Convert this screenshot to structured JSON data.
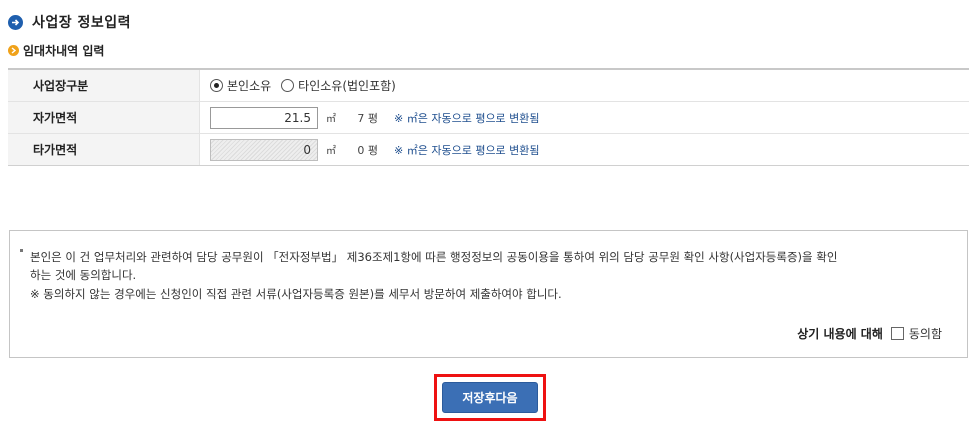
{
  "header": {
    "title": "사업장 정보입력",
    "subtitle": "임대차내역 입력"
  },
  "form": {
    "type_label": "사업장구분",
    "radio_own": "본인소유",
    "radio_other": "타인소유(법인포함)",
    "radio_selected": "본인소유",
    "own_area_label": "자가면적",
    "own_area_value": "21.5",
    "own_area_unit": "㎡",
    "own_area_pyeong": "7 평",
    "other_area_label": "타가면적",
    "other_area_value": "0",
    "other_area_unit": "㎡",
    "other_area_pyeong": "0 평",
    "note": "자동으로 평으로 변환됨",
    "note_prefix": "※ ㎡은"
  },
  "consent": {
    "line1": "본인은 이 건 업무처리와 관련하여 담당 공무원이 「전자정부법」 제36조제1항에 따른 행정정보의 공동이용을 통하여 위의 담당 공무원 확인 사항(사업자등록증)을 확인",
    "line2": "하는 것에 동의합니다.",
    "line3": "※  동의하지 않는 경우에는 신청인이 직접 관련 서류(사업자등록증 원본)를 세무서 방문하여 제출하여야 합니다.",
    "agree_label": "상기 내용에 대해",
    "agree_checkbox_label": "동의함",
    "agree_checked": false
  },
  "actions": {
    "save_next": "저장후다음"
  },
  "colors": {
    "title_icon": "#1f5fae",
    "subtitle_icon": "#f0a21a",
    "note_text": "#1f4f8f",
    "save_button": "#3b6fb5",
    "highlight_border": "#ee1111"
  }
}
